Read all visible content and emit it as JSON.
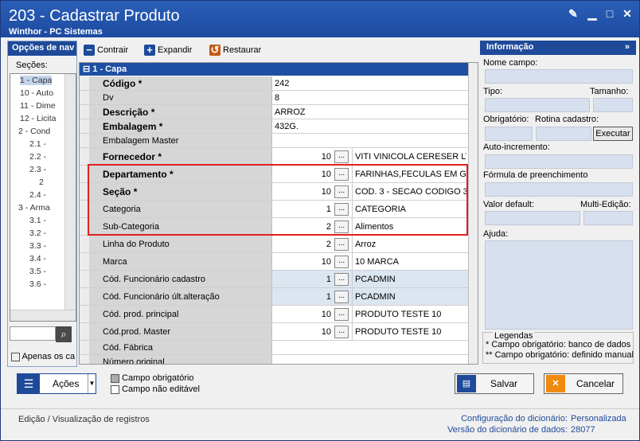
{
  "window": {
    "title": "203 - Cadastrar  Produto",
    "subtitle": "Winthor - PC Sistemas"
  },
  "left_panel": {
    "header": "Opções de nav",
    "secoes_label": "Seções:",
    "tree_items": [
      "1 - Capa",
      "10 - Auto",
      "11 - Dime",
      "12 - Licita",
      "2 - Cond",
      "2.1 -",
      "2.2 -",
      "2.3 -",
      "2",
      "2.4 -",
      "3 - Arma",
      "3.1 -",
      "3.2 -",
      "3.3 -",
      "3.4 -",
      "3.5 -",
      "3.6 -"
    ],
    "apenas_label": "Apenas os ca"
  },
  "toolbar": {
    "contrair": "Contrair",
    "expandir": "Expandir",
    "restaurar": "Restaurar"
  },
  "grid": {
    "group": "1 - Capa",
    "rows": [
      {
        "label": "Código *",
        "bold": true,
        "value": "242"
      },
      {
        "label": "Dv",
        "bold": false,
        "value": "8"
      },
      {
        "label": "Descrição *",
        "bold": true,
        "value": "ARROZ"
      },
      {
        "label": "Embalagem *",
        "bold": true,
        "value": "432G."
      },
      {
        "label": "Embalagem Master",
        "bold": false,
        "value": ""
      },
      {
        "label": "Fornecedor *",
        "bold": true,
        "num": "10",
        "desc": "VITI VINICOLA CERESER LTD"
      },
      {
        "label": "Departamento *",
        "bold": true,
        "num": "10",
        "desc": "FARINHAS,FECULAS EM GER"
      },
      {
        "label": "Seção *",
        "bold": true,
        "num": "10",
        "desc": "COD. 3 - SECAO CODIGO 3"
      },
      {
        "label": "Categoria",
        "bold": false,
        "num": "1",
        "desc": "CATEGORIA"
      },
      {
        "label": "Sub-Categoria",
        "bold": false,
        "num": "2",
        "desc": "Alimentos"
      },
      {
        "label": "Linha do Produto",
        "bold": false,
        "num": "2",
        "desc": "Arroz"
      },
      {
        "label": "Marca",
        "bold": false,
        "num": "10",
        "desc": "10 MARCA"
      },
      {
        "label": "Cód. Funcionário cadastro",
        "bold": false,
        "num": "1",
        "desc": "PCADMIN",
        "alt": true
      },
      {
        "label": "Cód. Funcionário últ.alteração",
        "bold": false,
        "num": "1",
        "desc": "PCADMIN",
        "alt": true
      },
      {
        "label": "Cód. prod. principal",
        "bold": false,
        "num": "10",
        "desc": "PRODUTO TESTE 10"
      },
      {
        "label": "Cód.prod. Master",
        "bold": false,
        "num": "10",
        "desc": "PRODUTO TESTE 10"
      },
      {
        "label": "Cód. Fábrica",
        "bold": false,
        "value": ""
      },
      {
        "label": "Número original",
        "bold": false,
        "value": ""
      }
    ]
  },
  "right_panel": {
    "header": "Informação",
    "nome_campo": "Nome campo:",
    "tipo": "Tipo:",
    "tamanho": "Tamanho:",
    "obrigatorio": "Obrigatório:",
    "rotina": "Rotina cadastro:",
    "executar": "Executar",
    "autoinc": "Auto-incremento:",
    "formula": "Fórmula de preenchimento",
    "valor_default": "Valor default:",
    "multi": "Multi-Edição:",
    "ajuda": "Ajuda:",
    "legendas": "Legendas",
    "leg1": "* Campo obrigatório: banco de dados",
    "leg2": "** Campo obrigatório: definido manual"
  },
  "bottom": {
    "acoes": "Ações",
    "campo_obrigatorio": "Campo obrigatório",
    "campo_nao_editavel": "Campo não editável",
    "salvar": "Salvar",
    "cancelar": "Cancelar"
  },
  "status": {
    "left": "Edição / Visualização de registros",
    "config_label": "Configuração do dicionário:",
    "config_value": "Personalizada",
    "versao_label": "Versão do dicionário de dados:",
    "versao_value": "28077"
  },
  "colors": {
    "accent": "#1e4a99",
    "highlight": "#e02020"
  }
}
